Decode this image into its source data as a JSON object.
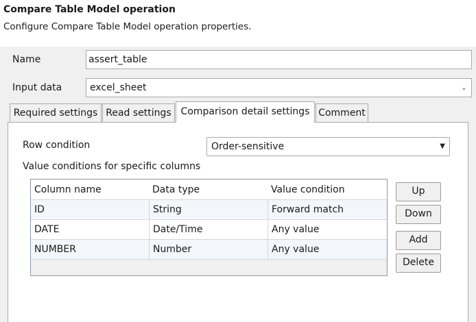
{
  "header": {
    "title": "Compare Table Model operation",
    "subtitle": "Configure Compare Table Model operation properties."
  },
  "form": {
    "name_label": "Name",
    "name_value": "assert_table",
    "input_data_label": "Input data",
    "input_data_value": "excel_sheet"
  },
  "tabs": [
    {
      "label": "Required settings",
      "active": false
    },
    {
      "label": "Read settings",
      "active": false
    },
    {
      "label": "Comparison detail settings",
      "active": true
    },
    {
      "label": "Comment",
      "active": false
    }
  ],
  "comparison": {
    "row_condition_label": "Row condition",
    "row_condition_value": "Order-sensitive",
    "value_conditions_label": "Value conditions for specific columns",
    "table": {
      "columns": [
        "Column name",
        "Data type",
        "Value condition"
      ],
      "rows": [
        [
          "ID",
          "String",
          "Forward match"
        ],
        [
          "DATE",
          "Date/Time",
          "Any value"
        ],
        [
          "NUMBER",
          "Number",
          "Any value"
        ]
      ]
    },
    "buttons": {
      "up": "Up",
      "down": "Down",
      "add": "Add",
      "delete": "Delete"
    }
  },
  "icons": {
    "combo_arrow": "chevron-down-icon",
    "select_arrow": "caret-down-icon"
  }
}
